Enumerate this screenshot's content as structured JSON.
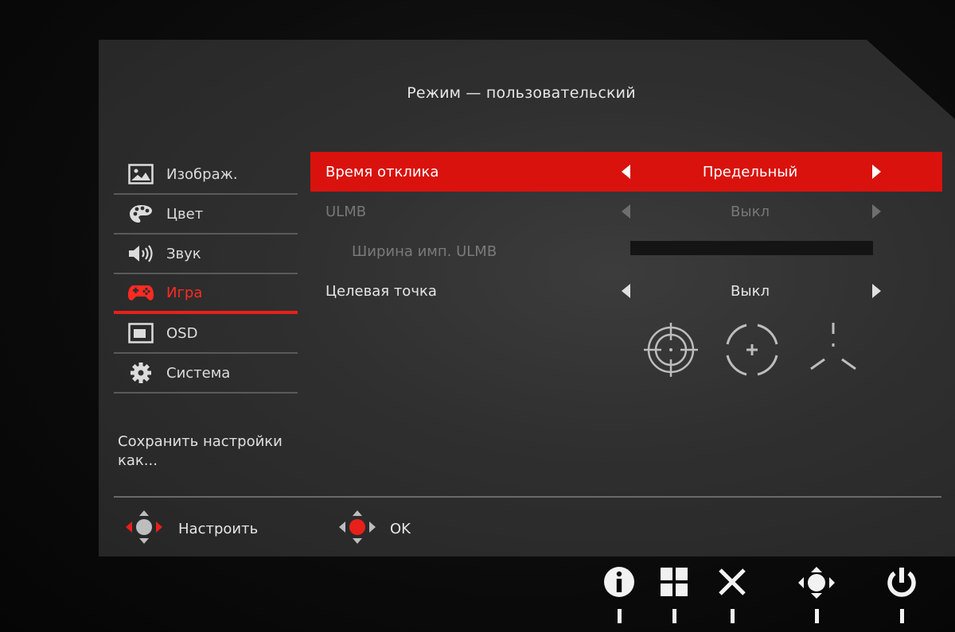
{
  "header": {
    "title": "Режим — пользовательский"
  },
  "sidebar": {
    "items": [
      {
        "label": "Изображ.",
        "icon": "image-icon",
        "active": false
      },
      {
        "label": "Цвет",
        "icon": "palette-icon",
        "active": false
      },
      {
        "label": "Звук",
        "icon": "speaker-icon",
        "active": false
      },
      {
        "label": "Игра",
        "icon": "gamepad-icon",
        "active": true
      },
      {
        "label": "OSD",
        "icon": "osd-window-icon",
        "active": false
      },
      {
        "label": "Система",
        "icon": "gear-icon",
        "active": false
      }
    ],
    "save_label": "Сохранить настройки как..."
  },
  "main": {
    "rows": [
      {
        "label": "Время отклика",
        "value": "Предельный",
        "state": "selected"
      },
      {
        "label": "ULMB",
        "value": "Выкл",
        "state": "disabled"
      },
      {
        "label": "Ширина имп. ULMB",
        "value": "",
        "state": "disabled-sub"
      },
      {
        "label": "Целевая точка",
        "value": "Выкл",
        "state": "normal"
      }
    ],
    "crosshair_options": [
      "crosshair-circle-icon",
      "crosshair-ring-icon",
      "crosshair-tri-icon"
    ]
  },
  "footer": {
    "adjust_label": "Настроить",
    "ok_label": "OK"
  },
  "hardware_buttons": [
    "info-icon",
    "menu-grid-icon",
    "close-icon",
    "navigation-joystick-icon",
    "power-icon"
  ],
  "colors": {
    "accent": "#d9120d",
    "active_text": "#ff2a22",
    "panel_bg": "#333333"
  }
}
